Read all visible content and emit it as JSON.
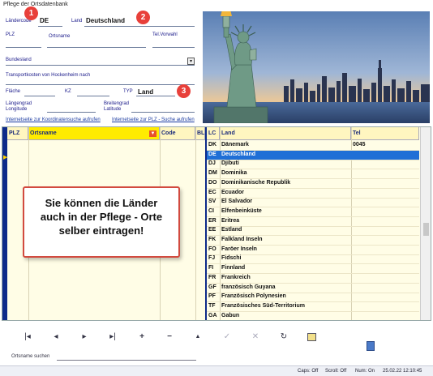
{
  "window": {
    "title": "Pflege der Ortsdatenbank"
  },
  "form": {
    "laendercode_label": "Ländercode",
    "laendercode_value": "DE",
    "land_label": "Land",
    "land_value": "Deutschland",
    "plz_label": "PLZ",
    "ortsname_label": "Ortsname",
    "telvorwahl_label": "Tel.Vorwahl",
    "bundesland_label": "Bundesland",
    "transport_label": "Transportkosten von Hockenheim nach",
    "flaeche_label": "Fläche",
    "kz_label": "KZ",
    "typ_label": "TYP",
    "typ_value": "Land",
    "laengengrad_label": "Längengrad",
    "longitude_label": "Longitude",
    "breitengrad_label": "Breitengrad",
    "latitude_label": "Latitude",
    "link_koordinaten": "Internetseite zur Koordinatensuche aufrufen",
    "link_plz": "Internetseite zur PLZ - Suche aufrufen"
  },
  "badges": [
    "1",
    "2",
    "3"
  ],
  "grid": {
    "headers": {
      "plz": "PLZ",
      "ortsname": "Ortsname",
      "code": "Code",
      "bl": "BL",
      "lc": "LC",
      "land": "Land",
      "tel": "Tel"
    },
    "countries": [
      {
        "lc": "DK",
        "land": "Dänemark",
        "tel": "0045"
      },
      {
        "lc": "DE",
        "land": "Deutschland",
        "tel": ""
      },
      {
        "lc": "DJ",
        "land": "Djibuti",
        "tel": ""
      },
      {
        "lc": "DM",
        "land": "Dominika",
        "tel": ""
      },
      {
        "lc": "DO",
        "land": "Dominikanische Republik",
        "tel": ""
      },
      {
        "lc": "EC",
        "land": "Ecuador",
        "tel": ""
      },
      {
        "lc": "SV",
        "land": "El Salvador",
        "tel": ""
      },
      {
        "lc": "CI",
        "land": "Elfenbeinküste",
        "tel": ""
      },
      {
        "lc": "ER",
        "land": "Eritrea",
        "tel": ""
      },
      {
        "lc": "EE",
        "land": "Estland",
        "tel": ""
      },
      {
        "lc": "FK",
        "land": "Falkland Inseln",
        "tel": ""
      },
      {
        "lc": "FO",
        "land": "Faröer Inseln",
        "tel": ""
      },
      {
        "lc": "FJ",
        "land": "Fidschi",
        "tel": ""
      },
      {
        "lc": "FI",
        "land": "Finnland",
        "tel": ""
      },
      {
        "lc": "FR",
        "land": "Frankreich",
        "tel": ""
      },
      {
        "lc": "GF",
        "land": "französisch Guyana",
        "tel": ""
      },
      {
        "lc": "PF",
        "land": "Französisch Polynesien",
        "tel": ""
      },
      {
        "lc": "TF",
        "land": "Französisches Süd-Territorium",
        "tel": ""
      },
      {
        "lc": "GA",
        "land": "Gabun",
        "tel": ""
      }
    ],
    "selected_index": 1
  },
  "callout": {
    "line1": "Sie können die Länder",
    "line2": "auch in der Pflege - Orte",
    "line3": "selber eintragen!"
  },
  "toolbar": {
    "first": "|◂",
    "prev": "◂",
    "next": "▸",
    "last": "▸|",
    "add": "+",
    "delete": "−",
    "up": "▲",
    "post": "✓",
    "cancel": "✕",
    "refresh": "↻"
  },
  "search": {
    "label": "Ortsname suchen",
    "value": ""
  },
  "statusbar": {
    "caps": "Caps: Off",
    "scroll": "Scroll: Off",
    "num": "Num: On",
    "datetime": "25.02.22 12:10:45"
  }
}
